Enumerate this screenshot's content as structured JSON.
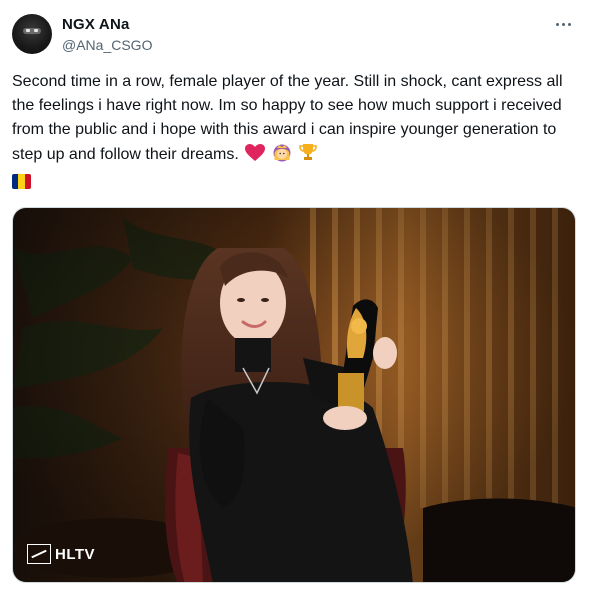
{
  "tweet": {
    "author_name": "NGX ANa",
    "author_handle": "@ANa_CSGO",
    "text": "Second time in a row, female player of the year. Still in shock, cant express all the feelings i have right now. Im so happy to see how much support i received from the public and i hope with this award i can inspire younger generation to step up and follow their dreams.",
    "emojis": [
      "red-heart",
      "princess",
      "trophy",
      "romania-flag"
    ],
    "media_watermark": "HLTV"
  },
  "colors": {
    "text": "#0f1419",
    "secondary": "#536471",
    "heart": "#e0245e",
    "flag": [
      "#002b7f",
      "#fcd116",
      "#ce1126"
    ]
  }
}
